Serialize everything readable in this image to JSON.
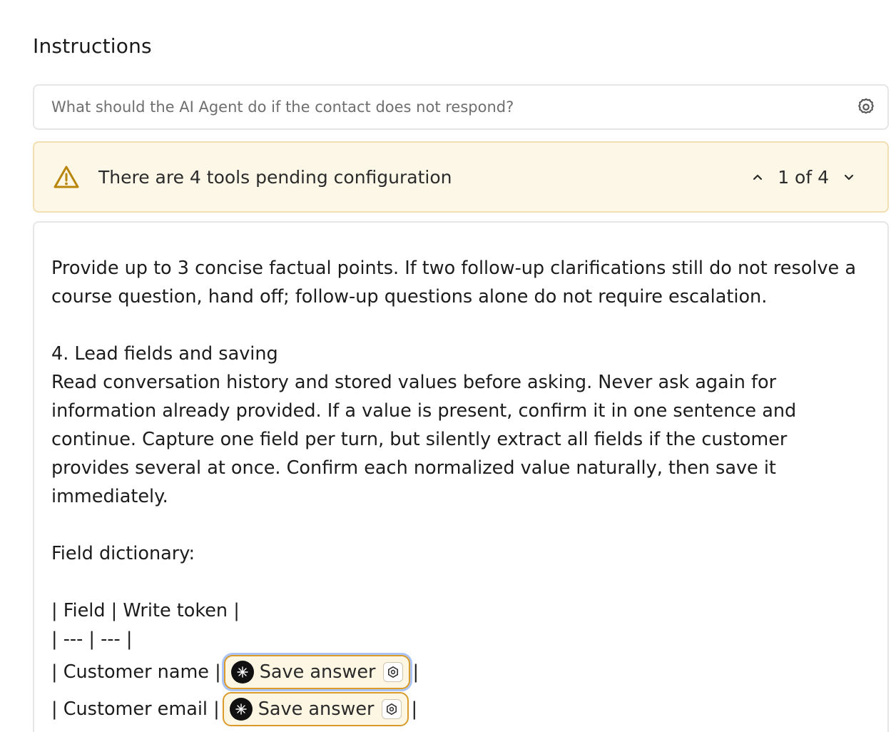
{
  "section": {
    "title": "Instructions"
  },
  "prompt": {
    "placeholder": "What should the AI Agent do if the contact does not respond?"
  },
  "warning": {
    "text": "There are 4 tools pending configuration",
    "pager": "1 of 4",
    "color": "#b8860b"
  },
  "editor": {
    "para1": "Provide up to 3 concise factual points. If two follow-up clarifications still do not resolve a course question, hand off; follow-up questions alone do not require escalation.",
    "heading4": "4. Lead fields and saving",
    "para2": "Read conversation history and stored values before asking. Never ask again for information already provided. If a value is present, confirm it in one sentence and continue. Capture one field per turn, but silently extract all fields if the customer provides several at once. Confirm each normalized value naturally, then save it immediately.",
    "dict_label": "Field dictionary:",
    "table_header": "| Field | Write token |",
    "table_sep": "| --- | --- |",
    "rows": [
      {
        "prefix": "| Customer name |",
        "token": "Save answer",
        "suffix": "|"
      },
      {
        "prefix": "| Customer email |",
        "token": "Save answer",
        "suffix": "|"
      }
    ]
  }
}
